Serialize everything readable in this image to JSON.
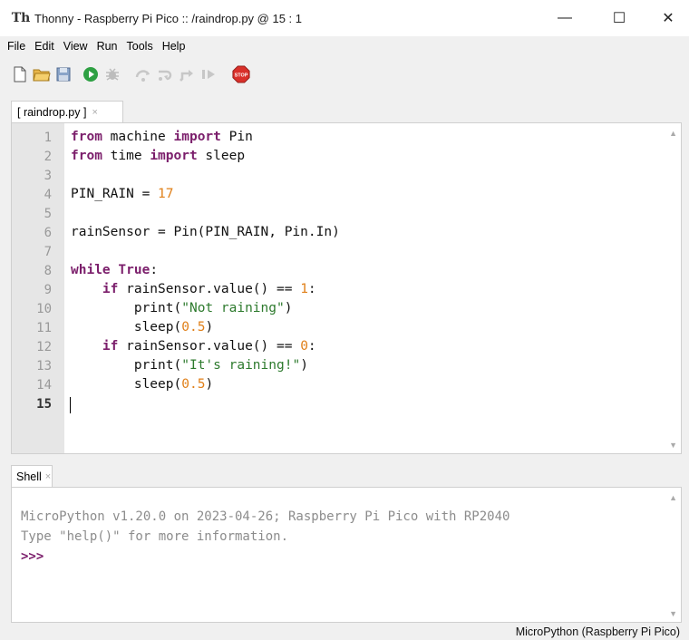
{
  "window": {
    "title": "Thonny  -  Raspberry Pi Pico :: /raindrop.py  @  15 : 1",
    "logo_text": "Th",
    "minimize": "—",
    "maximize": "☐",
    "close": "✕"
  },
  "menu": [
    "File",
    "Edit",
    "View",
    "Run",
    "Tools",
    "Help"
  ],
  "toolbar": {
    "icons": [
      "new-file-icon",
      "open-folder-icon",
      "save-icon",
      "run-icon",
      "debug-icon",
      "step-over-icon",
      "step-into-icon",
      "step-out-icon",
      "resume-icon",
      "stop-icon"
    ],
    "stop_label": "STOP"
  },
  "editor": {
    "tab_label": "[ raindrop.py ]",
    "tab_close": "×",
    "line_numbers": [
      "1",
      "2",
      "3",
      "4",
      "5",
      "6",
      "7",
      "8",
      "9",
      "10",
      "11",
      "12",
      "13",
      "14",
      "15"
    ],
    "current_line": "15"
  },
  "shell": {
    "tab_label": "Shell",
    "tab_close": "×",
    "line1": "MicroPython v1.20.0 on 2023-04-26; Raspberry Pi Pico with RP2040",
    "line2": "Type \"help()\" for more information.",
    "prompt": ">>>"
  },
  "status": {
    "interpreter": "MicroPython (Raspberry Pi Pico)"
  },
  "code": {
    "l1": {
      "k1": "from",
      "t1": " machine ",
      "k2": "import",
      "t2": " Pin"
    },
    "l2": {
      "k1": "from",
      "t1": " time ",
      "k2": "import",
      "t2": " sleep"
    },
    "l4": {
      "t1": "PIN_RAIN = ",
      "n1": "17"
    },
    "l6": {
      "t1": "rainSensor = Pin(PIN_RAIN, Pin.In)"
    },
    "l8": {
      "k1": "while",
      "t1": " ",
      "k2": "True",
      "t2": ":"
    },
    "l9": {
      "i": "    ",
      "k1": "if",
      "t1": " rainSensor.value() == ",
      "n1": "1",
      "t2": ":"
    },
    "l10": {
      "i": "        ",
      "t1": "print(",
      "s1": "\"Not raining\"",
      "t2": ")"
    },
    "l11": {
      "i": "        ",
      "t1": "sleep(",
      "n1": "0.5",
      "t2": ")"
    },
    "l12": {
      "i": "    ",
      "k1": "if",
      "t1": " rainSensor.value() == ",
      "n1": "0",
      "t2": ":"
    },
    "l13": {
      "i": "        ",
      "t1": "print(",
      "s1": "\"It's raining!\"",
      "t2": ")"
    },
    "l14": {
      "i": "        ",
      "t1": "sleep(",
      "n1": "0.5",
      "t2": ")"
    }
  }
}
